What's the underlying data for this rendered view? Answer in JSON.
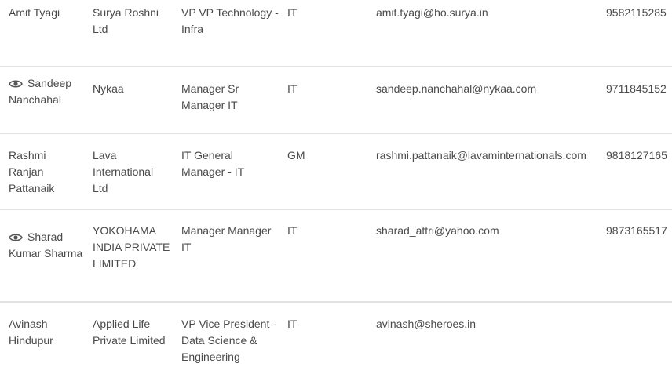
{
  "rows": [
    {
      "name": "Amit Tyagi",
      "viewed": false,
      "company": "Surya Roshni Ltd",
      "title": "VP VP Technology - Infra",
      "department": "IT",
      "email": "amit.tyagi@ho.surya.in",
      "phone": "9582115285"
    },
    {
      "name": "Sandeep Nanchahal",
      "viewed": true,
      "company": "Nykaa",
      "title": "Manager Sr Manager IT",
      "department": "IT",
      "email": "sandeep.nanchahal@nykaa.com",
      "phone": "9711845152"
    },
    {
      "name": "Rashmi Ranjan Pattanaik",
      "viewed": false,
      "company": "Lava International Ltd",
      "title": "IT General Manager - IT",
      "department": "GM",
      "email": "rashmi.pattanaik@lavaminternationals.com",
      "phone": "9818127165"
    },
    {
      "name": "Sharad Kumar Sharma",
      "viewed": true,
      "company": "YOKOHAMA INDIA PRIVATE LIMITED",
      "title": "Manager Manager IT",
      "department": "IT",
      "email": "sharad_attri@yahoo.com",
      "phone": "9873165517"
    },
    {
      "name": "Avinash Hindupur",
      "viewed": false,
      "company": "Applied Life Private Limited",
      "title": "VP Vice President - Data Science & Engineering",
      "department": "IT",
      "email": "avinash@sheroes.in",
      "phone": ""
    }
  ],
  "icons": {
    "viewed": "eye-icon"
  },
  "colors": {
    "text": "#4a4a4a",
    "divider": "#e2e2e2"
  }
}
